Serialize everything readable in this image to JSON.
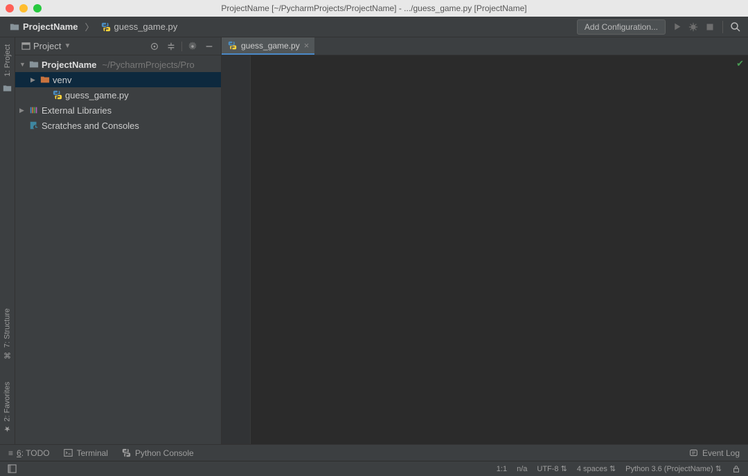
{
  "titlebar": {
    "title": "ProjectName [~/PycharmProjects/ProjectName] - .../guess_game.py [ProjectName]"
  },
  "breadcrumb": {
    "project": "ProjectName",
    "file": "guess_game.py"
  },
  "navbar": {
    "add_config": "Add Configuration..."
  },
  "left_strip": {
    "project": "1: Project",
    "structure": "7: Structure",
    "favorites": "2: Favorites"
  },
  "project_panel": {
    "title": "Project",
    "tree": {
      "root": "ProjectName",
      "root_hint": "~/PycharmProjects/Pro",
      "venv": "venv",
      "file": "guess_game.py",
      "external": "External Libraries",
      "scratches": "Scratches and Consoles"
    }
  },
  "tabs": {
    "active": "guess_game.py"
  },
  "bottom_tools": {
    "todo_num": "6",
    "todo": ": TODO",
    "terminal": "Terminal",
    "python_console": "Python Console",
    "event_log": "Event Log"
  },
  "statusbar": {
    "position": "1:1",
    "context": "n/a",
    "encoding": "UTF-8",
    "indent": "4 spaces",
    "interpreter": "Python 3.6 (ProjectName)"
  }
}
